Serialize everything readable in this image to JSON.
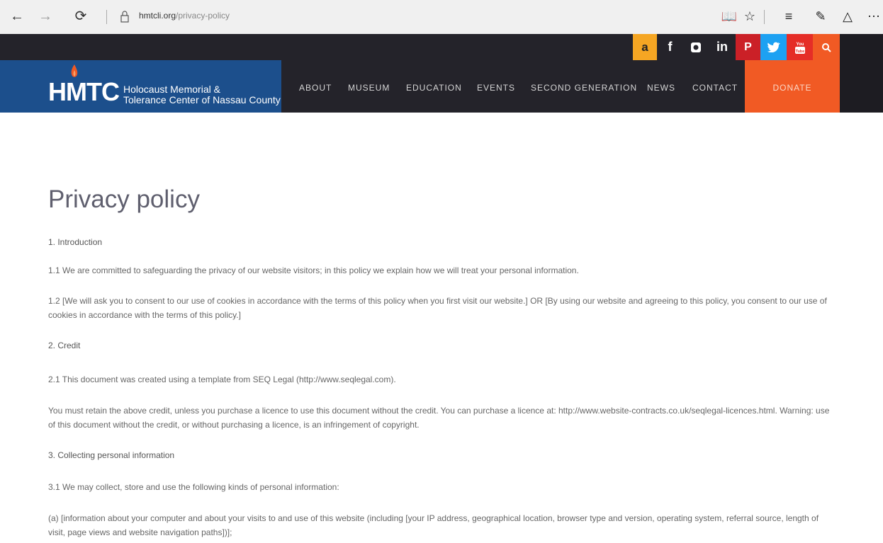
{
  "browser": {
    "url_domain": "hmtcli.org",
    "url_path": "/privacy-policy"
  },
  "social": [
    {
      "name": "amazon",
      "glyph": "a",
      "color": "#f5a623"
    },
    {
      "name": "facebook",
      "glyph": "f",
      "color": "#3b5998"
    },
    {
      "name": "instagram",
      "glyph": "◘",
      "color": "#2a6496"
    },
    {
      "name": "linkedin",
      "glyph": "in",
      "color": "#0b66a8"
    },
    {
      "name": "pinterest",
      "glyph": "P",
      "color": "#cb2027"
    },
    {
      "name": "twitter",
      "glyph": "t",
      "color": "#1da1f2"
    },
    {
      "name": "youtube",
      "glyph": "You Tube",
      "color": "#e52d27"
    },
    {
      "name": "search",
      "glyph": "⌕",
      "color": "#f15a24"
    }
  ],
  "logo": {
    "acronym": "HMTC",
    "line1": "Holocaust Memorial &",
    "line2": "Tolerance Center of Nassau County"
  },
  "nav": {
    "about": "ABOUT",
    "museum": "MUSEUM",
    "education": "EDUCATION",
    "events": "EVENTS",
    "second_generation": "SECOND GENERATION",
    "news": "NEWS",
    "contact": "CONTACT",
    "donate": "DONATE"
  },
  "page": {
    "title": "Privacy policy",
    "paragraphs": {
      "s1": "1. Introduction",
      "p11": "1.1 We are committed to safeguarding the privacy of our website visitors; in this policy we explain how we will treat your personal information.",
      "p12": "1.2 [We will ask you to consent to our use of cookies in accordance with the terms of this policy when you first visit our website.] OR [By using our website and agreeing to this policy, you consent to our use of cookies in accordance with the terms of this policy.]",
      "s2": "2. Credit",
      "p21": "2.1 This document was created using a template from SEQ Legal (http://www.seqlegal.com).",
      "p22": "You must retain the above credit, unless you purchase a licence to use this document without the credit. You can purchase a licence at: http://www.website-contracts.co.uk/seqlegal-licences.html. Warning: use of this document without the credit, or without purchasing a licence, is an infringement of copyright.",
      "s3": "3. Collecting personal information",
      "p31": "3.1 We may collect, store and use the following kinds of personal information:",
      "p31a": "(a) [information about your computer and about your visits to and use of this website (including [your IP address, geographical location, browser type and version, operating system, referral source, length of visit, page views and website navigation paths])];"
    }
  }
}
